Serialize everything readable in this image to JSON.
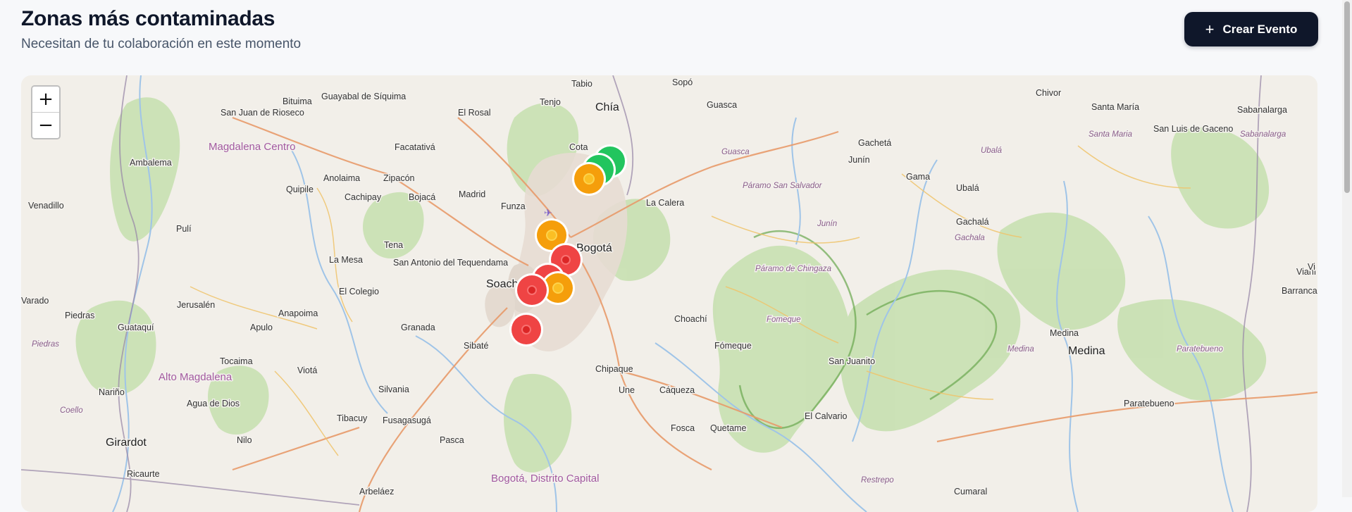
{
  "header": {
    "title": "Zonas más contaminadas",
    "subtitle": "Necesitan de tu colaboración en este momento"
  },
  "actions": {
    "create_event_label": "Crear Evento",
    "create_event_icon": "plus-icon"
  },
  "map": {
    "zoom_in_label": "+",
    "zoom_out_label": "−",
    "place_labels": [
      "Tabio",
      "Sopó",
      "Chivor",
      "Chía",
      "Tenjo",
      "Guasca",
      "Santa María",
      "Sabanalarga",
      "San Juan de Rioseco",
      "Bituima",
      "Guayabal de Síquima",
      "El Rosal",
      "Santa Maria",
      "San Luis de Gaceno",
      "Sabanalarga",
      "Magdalena Centro",
      "Facatativá",
      "Cota",
      "Guasca",
      "Gachetá",
      "Ubalá",
      "Junín",
      "Ambalema",
      "Gama",
      "Ubalá",
      "Anolaima",
      "Zipacón",
      "Quipile",
      "Páramo San Salvador",
      "Vianí",
      "Cachipay",
      "Bojacá",
      "Madrid",
      "La Calera",
      "Venadillo",
      "Funza",
      "Junín",
      "Gachalá",
      "Pulí",
      "Tena",
      "Bogotá",
      "Gachala",
      "La Mesa",
      "San Antonio del Tequendama",
      "Páramo de Chingaza",
      "Vi",
      "El Colegio",
      "Soacha",
      "Barranca Upía",
      "Jerusalén",
      "Anapoima",
      "Choachí",
      "Fomeque",
      "Varado",
      "Piedras",
      "Guataquí",
      "Apulo",
      "Granada",
      "Medina",
      "Sibaté",
      "Piedras",
      "Fómeque",
      "Medina",
      "Medina",
      "Paratebueno",
      "San Juanito",
      "Tocaima",
      "Chipaque",
      "Alto Magdalena",
      "Viotá",
      "Une",
      "Cáqueza",
      "Nariño",
      "Silvania",
      "Agua de Dios",
      "Paratebueno",
      "Coello",
      "Tibacuy",
      "Fusagasugá",
      "El Calvario",
      "Fosca",
      "Quetame",
      "Girardot",
      "Nilo",
      "Pasca",
      "Bogotá, Distrito Capital",
      "Restrepo",
      "Ricaurte",
      "Arbeláez",
      "Cumaral"
    ],
    "markers": [
      {
        "name": "pollution-marker-low-1",
        "level": "low",
        "color": "#22c55e"
      },
      {
        "name": "pollution-marker-low-2",
        "level": "low",
        "color": "#22c55e"
      },
      {
        "name": "pollution-marker-medium-1",
        "level": "medium",
        "color": "#f59e0b"
      },
      {
        "name": "pollution-marker-medium-2",
        "level": "medium",
        "color": "#f59e0b"
      },
      {
        "name": "pollution-marker-high-1",
        "level": "high",
        "color": "#ef4444"
      },
      {
        "name": "pollution-marker-high-2",
        "level": "high",
        "color": "#ef4444"
      },
      {
        "name": "pollution-marker-medium-3",
        "level": "medium",
        "color": "#f59e0b"
      },
      {
        "name": "pollution-marker-high-3",
        "level": "high",
        "color": "#ef4444"
      },
      {
        "name": "pollution-marker-high-4",
        "level": "high",
        "color": "#ef4444"
      }
    ]
  },
  "colors": {
    "button_bg": "#0f172a",
    "map_bg": "#f2efe9",
    "forest": "#b9d9a1",
    "marker_high": "#ef4444",
    "marker_medium": "#f59e0b",
    "marker_low": "#22c55e"
  }
}
